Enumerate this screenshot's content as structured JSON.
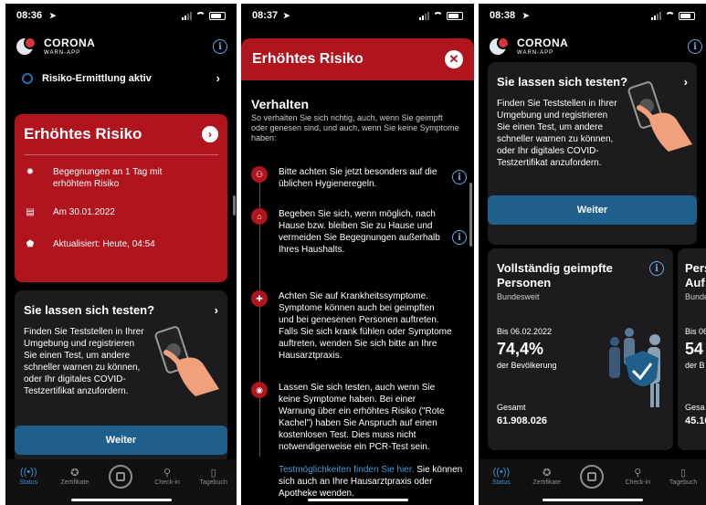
{
  "screens": [
    {
      "time": "08:36",
      "app": {
        "name": "CORONA",
        "subtitle": "WARN-APP"
      },
      "risk_detection": "Risiko-Ermittlung aktiv",
      "risk_card": {
        "title": "Erhöhtes Risiko",
        "rows": [
          "Begegnungen an 1 Tag mit erhöhtem Risiko",
          "Am 30.01.2022",
          "Aktualisiert: Heute, 04:54"
        ]
      },
      "test_card": {
        "title": "Sie lassen sich testen?",
        "text": "Finden Sie Teststellen in Ihrer Umgebung und registrieren Sie einen Test, um andere schneller warnen zu können, oder Ihr digitales COVID-Testzertifikat anzufordern.",
        "button": "Weiter"
      }
    },
    {
      "time": "08:37",
      "modal": {
        "title": "Erhöhtes Risiko",
        "section_title": "Verhalten",
        "section_sub": "So verhalten Sie sich richtig, auch, wenn Sie geimpft oder genesen sind, und auch, wenn Sie keine Symptome haben:",
        "rules": [
          "Bitte achten Sie jetzt besonders auf die üblichen Hygieneregeln.",
          "Begeben Sie sich, wenn möglich, nach Hause bzw. bleiben Sie zu Hause und vermeiden Sie Begegnungen außerhalb Ihres Haushalts.",
          "Achten Sie auf Krankheitssymptome. Symptome können auch bei geimpften und bei genesenen Personen auftreten. Falls Sie sich krank fühlen oder Symptome auftreten, wenden Sie sich bitte an Ihre Hausarztpraxis.",
          "Lassen Sie sich testen, auch wenn Sie keine Symptome haben. Bei einer Warnung über ein erhöhtes Risiko (\"Rote Kachel\") haben Sie Anspruch auf einen kostenlosen Test. Dies muss nicht notwendigerweise ein PCR-Test sein."
        ],
        "link_text": "Testmöglichkeiten finden Sie hier.",
        "after_link": " Sie können sich auch an Ihre Hausarztpraxis oder Apotheke wenden."
      }
    },
    {
      "time": "08:38",
      "app": {
        "name": "CORONA",
        "subtitle": "WARN-APP"
      },
      "test_card": {
        "title": "Sie lassen sich testen?",
        "text": "Finden Sie Teststellen in Ihrer Umgebung und registrieren Sie einen Test, um andere schneller warnen zu können, oder Ihr digitales COVID-Testzertifikat anzufordern.",
        "button": "Weiter"
      },
      "vacc_card": {
        "title": "Vollständig geimpfte Personen",
        "scope": "Bundesweit",
        "date": "Bis 06.02.2022",
        "percent": "74,4%",
        "percent_label": "der Bevölkerung",
        "total_label": "Gesamt",
        "total": "61.908.026"
      },
      "peek_card": {
        "title1": "Pers",
        "title2": "Auf",
        "scope": "Bunde",
        "date": "Bis 06.0",
        "percent": "54",
        "percent_label": "der B",
        "total_label": "Gesa",
        "total": "45.16"
      }
    }
  ],
  "tabs": [
    {
      "label": "Status",
      "icon": "radar-icon"
    },
    {
      "label": "Zertifikate",
      "icon": "certificate-icon"
    },
    {
      "label": "",
      "icon": "qr-scan-icon"
    },
    {
      "label": "Check-in",
      "icon": "location-icon"
    },
    {
      "label": "Tagebuch",
      "icon": "diary-icon"
    }
  ],
  "colors": {
    "risk_red": "#b0141c",
    "button_blue": "#1f5f8b",
    "active_tab": "#3d8fd6",
    "link_blue": "#4a9bd8"
  }
}
